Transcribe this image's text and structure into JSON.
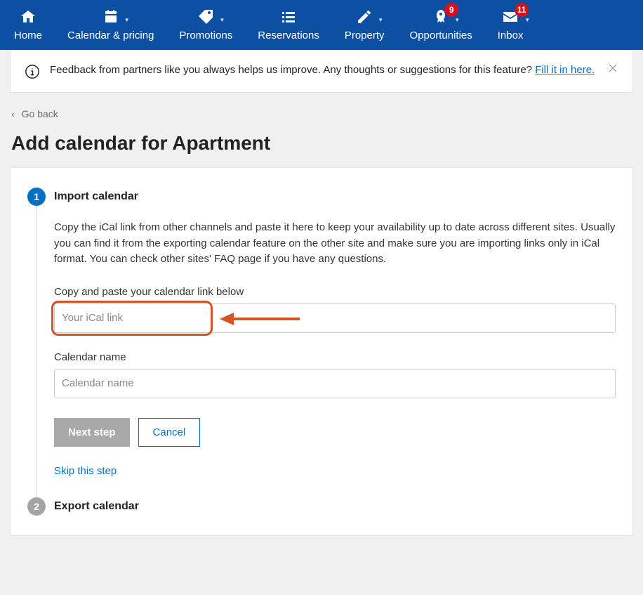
{
  "nav": {
    "home": "Home",
    "calendar": "Calendar & pricing",
    "promotions": "Promotions",
    "reservations": "Reservations",
    "property": "Property",
    "opportunities": "Opportunities",
    "opportunities_badge": "9",
    "inbox": "Inbox",
    "inbox_badge": "11"
  },
  "banner": {
    "text_before_link": "Feedback from partners like you always helps us improve. Any thoughts or suggestions for this feature? ",
    "link_text": "Fill it in here."
  },
  "goback": "Go back",
  "page_title": "Add calendar for Apartment",
  "step1": {
    "num": "1",
    "title": "Import calendar",
    "desc": "Copy the iCal link from other channels and paste it here to keep your availability up to date across different sites. Usually you can find it from the exporting calendar feature on the other site and make sure you are importing links only in iCal format. You can check other sites' FAQ page if you have any questions.",
    "ical_label": "Copy and paste your calendar link below",
    "ical_placeholder": "Your iCal link",
    "calname_label": "Calendar name",
    "calname_placeholder": "Calendar name",
    "next": "Next step",
    "cancel": "Cancel",
    "skip": "Skip this step"
  },
  "step2": {
    "num": "2",
    "title": "Export calendar"
  }
}
